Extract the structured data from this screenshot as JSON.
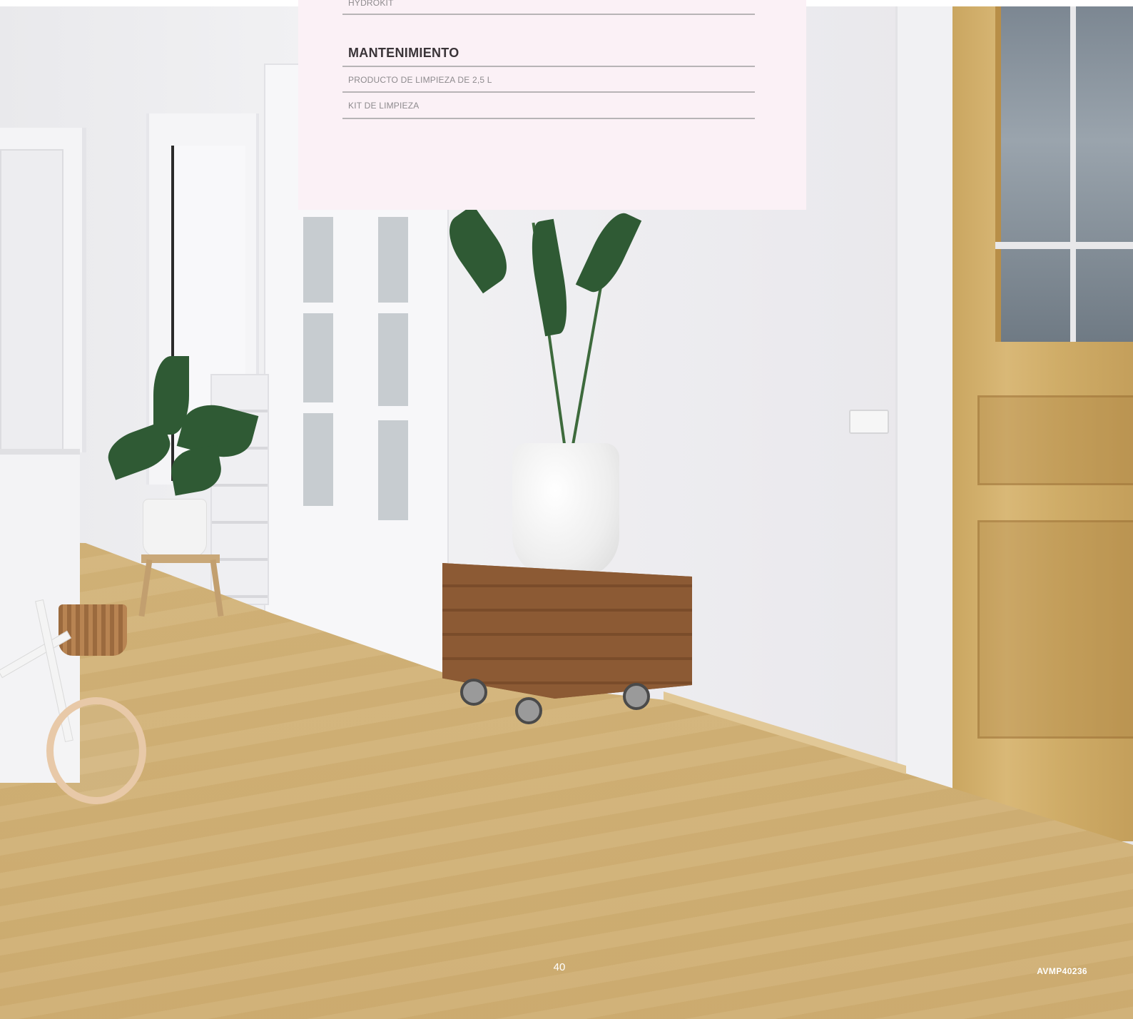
{
  "panel": {
    "rows_top": [
      "HYDROKIT"
    ],
    "section_title": "MANTENIMIENTO",
    "rows": [
      "PRODUCTO DE LIMPIEZA DE 2,5 L",
      "KIT DE LIMPIEZA"
    ],
    "background": "#fbf1f6"
  },
  "footer": {
    "page_number": "40",
    "code": "AVMP40236"
  }
}
